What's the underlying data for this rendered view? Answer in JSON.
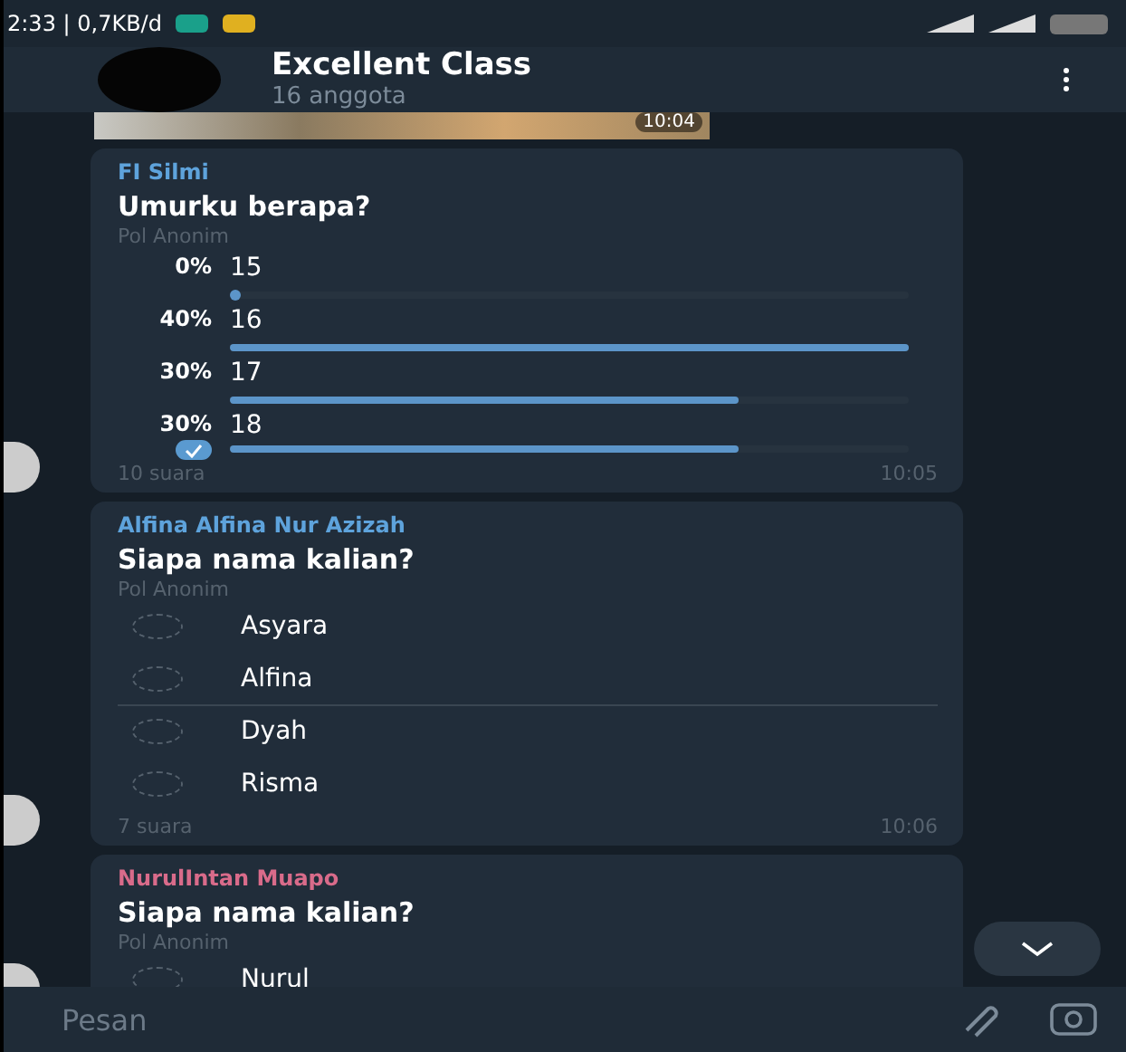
{
  "status_bar": {
    "text": "2:33 | 0,7KB/d"
  },
  "header": {
    "title": "Excellent Class",
    "subtitle": "16 anggota"
  },
  "messages": [
    {
      "kind": "photo",
      "time": "10:04"
    },
    {
      "kind": "results",
      "sender": "FI Silmi",
      "color": "#5ea3dc",
      "question": "Umurku berapa?",
      "poll_type": "Pol Anonim",
      "options": [
        {
          "percent": "0%",
          "label": "15",
          "level": 0,
          "selected": false
        },
        {
          "percent": "40%",
          "label": "16",
          "level": 1,
          "selected": false
        },
        {
          "percent": "30%",
          "label": "17",
          "level": 0.75,
          "selected": false
        },
        {
          "percent": "30%",
          "label": "18",
          "level": 0.75,
          "selected": true
        }
      ],
      "votes": "10 suara",
      "time": "10:05"
    },
    {
      "kind": "vote",
      "sender": "Alfina Alfina Nur Azizah",
      "color": "#5ea3dc",
      "question": "Siapa nama kalian?",
      "poll_type": "Pol Anonim",
      "options": [
        {
          "label": "Asyara",
          "selected": false
        },
        {
          "label": "Alfina",
          "selected": false
        },
        {
          "label": "Dyah",
          "selected": false
        },
        {
          "label": "Risma",
          "selected": false
        }
      ],
      "votes": "7 suara",
      "time": "10:06"
    },
    {
      "kind": "vote",
      "sender": "NurulIntan Muapo",
      "color": "#d96b8a",
      "question": "Siapa nama kalian?",
      "poll_type": "Pol Anonim",
      "options": [
        {
          "label": "Nurul",
          "selected": false
        }
      ]
    }
  ],
  "composer": {
    "placeholder": "Pesan"
  }
}
